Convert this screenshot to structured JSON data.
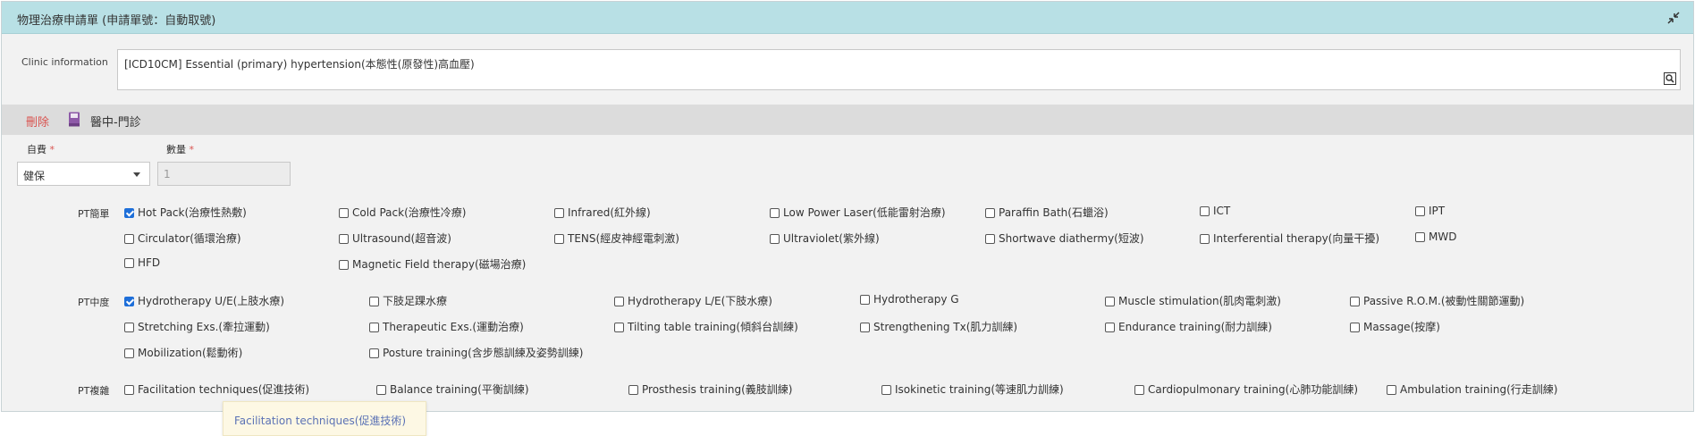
{
  "window": {
    "title": "物理治療申請單 (申請單號：自動取號)"
  },
  "clinic": {
    "label": "Clinic information",
    "value": "[ICD10CM] Essential (primary) hypertension(本態性(原發性)高血壓)"
  },
  "toolbar": {
    "delete_label": "刪除",
    "template_label": "醫中-門診"
  },
  "form": {
    "payment_label": "自費",
    "payment_value": "健保",
    "quantity_label": "數量",
    "quantity_value": "1",
    "required_mark": "*"
  },
  "groups": [
    {
      "label": "PT簡單",
      "options": [
        {
          "label": "Hot Pack(治療性熱敷)",
          "checked": true
        },
        {
          "label": "Cold Pack(治療性冷療)",
          "checked": false
        },
        {
          "label": "Infrared(紅外線)",
          "checked": false
        },
        {
          "label": "Low Power Laser(低能雷射治療)",
          "checked": false
        },
        {
          "label": "Paraffin Bath(石蠟浴)",
          "checked": false
        },
        {
          "label": "ICT",
          "checked": false
        },
        {
          "label": "IPT",
          "checked": false
        },
        {
          "label": "Circulator(循環治療)",
          "checked": false
        },
        {
          "label": "Ultrasound(超音波)",
          "checked": false
        },
        {
          "label": "TENS(經皮神經電刺激)",
          "checked": false
        },
        {
          "label": "Ultraviolet(紫外線)",
          "checked": false
        },
        {
          "label": "Shortwave diathermy(短波)",
          "checked": false
        },
        {
          "label": "Interferential therapy(向量干擾)",
          "checked": false
        },
        {
          "label": "MWD",
          "checked": false
        },
        {
          "label": "HFD",
          "checked": false
        },
        {
          "label": "Magnetic Field therapy(磁場治療)",
          "checked": false
        }
      ]
    },
    {
      "label": "PT中度",
      "options": [
        {
          "label": "Hydrotherapy U/E(上肢水療)",
          "checked": true
        },
        {
          "label": "下肢足踝水療",
          "checked": false
        },
        {
          "label": "Hydrotherapy L/E(下肢水療)",
          "checked": false
        },
        {
          "label": "Hydrotherapy G",
          "checked": false
        },
        {
          "label": "Muscle stimulation(肌肉電刺激)",
          "checked": false
        },
        {
          "label": "Passive R.O.M.(被動性關節運動)",
          "checked": false
        },
        {
          "label": "Stretching Exs.(牽拉運動)",
          "checked": false
        },
        {
          "label": "Therapeutic Exs.(運動治療)",
          "checked": false
        },
        {
          "label": "Tilting table training(傾斜台訓練)",
          "checked": false
        },
        {
          "label": "Strengthening Tx(肌力訓練)",
          "checked": false
        },
        {
          "label": "Endurance training(耐力訓練)",
          "checked": false
        },
        {
          "label": "Massage(按摩)",
          "checked": false
        },
        {
          "label": "Mobilization(鬆動術)",
          "checked": false
        },
        {
          "label": "Posture training(含步態訓練及姿勢訓練)",
          "checked": false
        }
      ]
    },
    {
      "label": "PT複雜",
      "options": [
        {
          "label": "Facilitation techniques(促進技術)",
          "checked": false
        },
        {
          "label": "Balance training(平衡訓練)",
          "checked": false
        },
        {
          "label": "Prosthesis training(義肢訓練)",
          "checked": false
        },
        {
          "label": "Isokinetic training(等速肌力訓練)",
          "checked": false
        },
        {
          "label": "Cardiopulmonary training(心肺功能訓練)",
          "checked": false
        },
        {
          "label": "Ambulation training(行走訓練)",
          "checked": false
        }
      ]
    }
  ],
  "tooltip": {
    "text": "Facilitation techniques(促進技術)"
  },
  "colors": {
    "titlebar": "#b8e0e5",
    "toolbar": "#dcdcdc",
    "panel": "#f2f2f2",
    "required": "#d9534f",
    "checkbox_checked": "#1e6fd9",
    "tooltip_text": "#5b72b5"
  }
}
